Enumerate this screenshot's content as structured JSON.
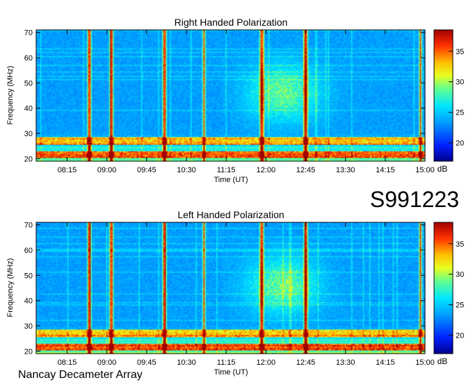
{
  "dataset_id": "S991223",
  "footer": "Nancay Decameter Array",
  "chart_data": [
    {
      "type": "heatmap",
      "title": "Right Handed Polarization",
      "xlabel": "Time (UT)",
      "ylabel": "Frequency (MHz)",
      "x_ticks": [
        "08:15",
        "09:00",
        "09:45",
        "10:30",
        "11:15",
        "12:00",
        "12:45",
        "13:30",
        "14:15",
        "15:00"
      ],
      "xlim": [
        "07:40",
        "15:00"
      ],
      "y_ticks": [
        20,
        30,
        40,
        50,
        60,
        70
      ],
      "ylim": [
        19,
        71
      ],
      "colorbar": {
        "label": "dB",
        "ticks": [
          20,
          25,
          30,
          35
        ],
        "range": [
          17,
          38.5
        ]
      },
      "emission": {
        "strong_bands_mhz": [
          [
            21,
            22.5
          ],
          [
            26,
            28
          ]
        ],
        "brief_bursts_ut": [
          "08:40",
          "09:05",
          "10:05",
          "10:50",
          "11:55",
          "12:45",
          "14:55"
        ],
        "diffuse_enhancement_ut": [
          "11:10",
          "14:30"
        ],
        "diffuse_peak_ut": "12:20"
      }
    },
    {
      "type": "heatmap",
      "title": "Left Handed Polarization",
      "xlabel": "Time (UT)",
      "ylabel": "Frequency (MHz)",
      "x_ticks": [
        "08:15",
        "09:00",
        "09:45",
        "10:30",
        "11:15",
        "12:00",
        "12:45",
        "13:30",
        "14:15",
        "15:00"
      ],
      "xlim": [
        "07:40",
        "15:00"
      ],
      "y_ticks": [
        20,
        30,
        40,
        50,
        60,
        70
      ],
      "ylim": [
        19,
        71
      ],
      "colorbar": {
        "label": "dB",
        "ticks": [
          20,
          25,
          30,
          35
        ],
        "range": [
          17,
          38.5
        ]
      },
      "emission": {
        "strong_bands_mhz": [
          [
            21,
            22.5
          ],
          [
            26,
            28
          ]
        ],
        "brief_bursts_ut": [
          "08:40",
          "09:05",
          "10:05",
          "10:50",
          "11:55",
          "12:45",
          "14:55"
        ],
        "diffuse_enhancement_ut": [
          "11:10",
          "14:30"
        ],
        "diffuse_peak_ut": "12:20"
      }
    }
  ]
}
